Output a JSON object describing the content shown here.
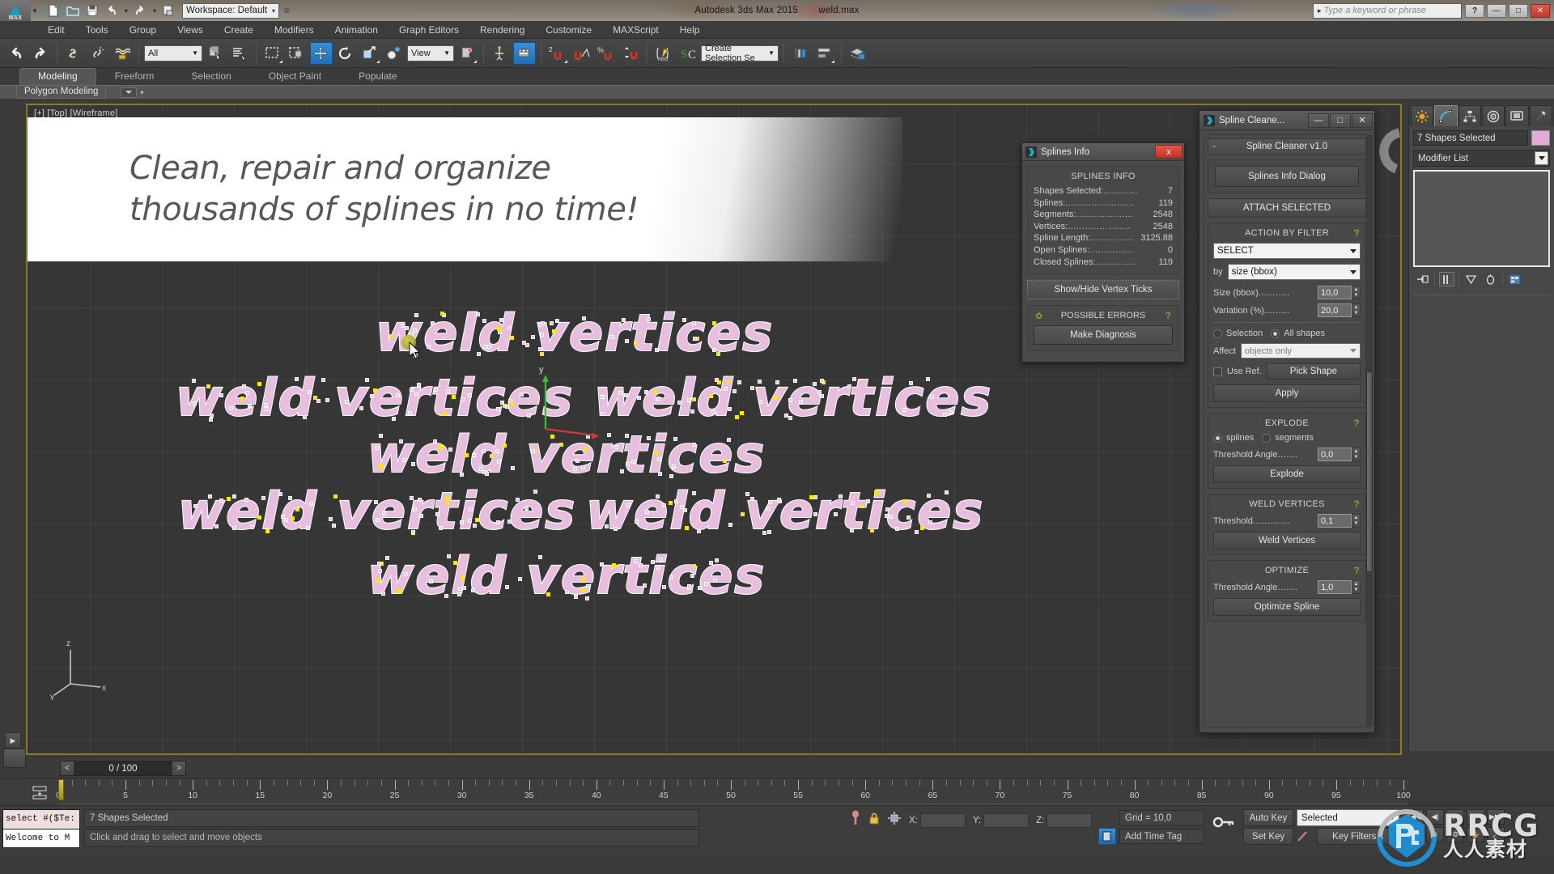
{
  "titlebar": {
    "app_title": "Autodesk 3ds Max  2015",
    "file_name": "weld.max",
    "workspace": "Workspace: Default",
    "search_placeholder": "Type a keyword or phrase",
    "logo_label": "MAX",
    "minimize": "—",
    "maximize": "□",
    "close": "✕",
    "help": "?"
  },
  "menu": {
    "items": [
      "Edit",
      "Tools",
      "Group",
      "Views",
      "Create",
      "Modifiers",
      "Animation",
      "Graph Editors",
      "Rendering",
      "Customize",
      "MAXScript",
      "Help"
    ]
  },
  "toolbar": {
    "selection_filter": "All",
    "reference_coord": "View",
    "named_selection_set": "Create Selection Se",
    "snap_label_2": "2",
    "snap_label_angle": "%"
  },
  "ribbon": {
    "tabs": [
      "Modeling",
      "Freeform",
      "Selection",
      "Object Paint",
      "Populate"
    ],
    "selected_tab": "Modeling",
    "panel_label": "Polygon Modeling"
  },
  "viewport": {
    "label": "[+] [Top] [Wireframe]",
    "banner_line1": "Clean, repair and organize",
    "banner_line2": "thousands of splines in no time!",
    "spline_text": "weld vertices",
    "axis_x": "x",
    "axis_y": "y",
    "axis_z": "z",
    "spline_color": "#e7bede",
    "selected_vertex_color": "#ffe800",
    "viewport_border_color": "#8a7a28"
  },
  "splines_info_dialog": {
    "title": "Splines Info",
    "close": "x",
    "group_title": "SPLINES INFO",
    "rows": [
      {
        "label": "Shapes Selected:",
        "dots": "............",
        "value": "7"
      },
      {
        "label": "Splines:",
        "dots": "........................",
        "value": "119"
      },
      {
        "label": "Segments:",
        "dots": "....................",
        "value": "2548"
      },
      {
        "label": "Vertices:",
        "dots": "......................",
        "value": "2548"
      },
      {
        "label": "Spline Length:",
        "dots": "...............",
        "value": "3125.88"
      },
      {
        "label": "Open Splines:",
        "dots": "...............",
        "value": "0"
      },
      {
        "label": "Closed Splines:",
        "dots": "..............",
        "value": "119"
      }
    ],
    "show_hide_button": "Show/Hide Vertex Ticks",
    "errors_title": "POSSIBLE ERRORS",
    "errors_help": "?",
    "make_diagnosis_button": "Make Diagnosis"
  },
  "spline_cleaner": {
    "window_title": "Spline Cleane...",
    "minimize": "—",
    "maximize": "□",
    "close": "✕",
    "rollout_title": "Spline Cleaner v1.0",
    "rollout_collapse": "-",
    "splines_info_dialog_button": "Splines Info Dialog",
    "attach_selected_button": "ATTACH SELECTED",
    "action_by_filter": {
      "title": "ACTION BY FILTER",
      "help": "?",
      "action": "SELECT",
      "by_label": "by",
      "by_value": "size (bbox)",
      "size_label": "Size (bbox)",
      "size_dots": "...........",
      "size_value": "10,0",
      "variation_label": "Variation (%)",
      "variation_dots": ".........",
      "variation_value": "20,0",
      "radio_selection": "Selection",
      "radio_all_shapes": "All shapes",
      "radio_selected": "All shapes",
      "affect_label": "Affect",
      "affect_value": "objects only",
      "use_ref_label": "Use Ref.",
      "pick_shape_button": "Pick Shape",
      "apply_button": "Apply"
    },
    "explode": {
      "title": "EXPLODE",
      "help": "?",
      "radio_splines": "splines",
      "radio_segments": "segments",
      "radio_selected": "splines",
      "threshold_label": "Threshold Angle",
      "threshold_dots": ".......",
      "threshold_value": "0,0",
      "button": "Explode"
    },
    "weld_vertices": {
      "title": "WELD VERTICES",
      "help": "?",
      "threshold_label": "Threshold",
      "threshold_dots": ".............",
      "threshold_value": "0,1",
      "button": "Weld Vertices"
    },
    "optimize": {
      "title": "OPTIMIZE",
      "help": "?",
      "threshold_label": "Threshold Angle",
      "threshold_dots": ".......",
      "threshold_value": "1,0",
      "button": "Optimize Spline"
    }
  },
  "command_panel": {
    "tabs": [
      "create-tab",
      "modify-tab",
      "hierarchy-tab",
      "motion-tab",
      "display-tab",
      "utilities-tab"
    ],
    "selected_tab_index": 1,
    "object_name": "7 Shapes Selected",
    "object_color": "#e3abd5",
    "modifier_list": "Modifier List"
  },
  "timeline": {
    "frame_display": "0 / 100",
    "prev_arrow": "<",
    "next_arrow": ">",
    "tick_labels": [
      0,
      5,
      10,
      15,
      20,
      25,
      30,
      35,
      40,
      45,
      50,
      55,
      60,
      65,
      70,
      75,
      80,
      85,
      90,
      95,
      100
    ],
    "range_start": 0,
    "range_end": 100,
    "current_frame": 0
  },
  "statusbar": {
    "maxscript_line1": "select #($Te:",
    "maxscript_line2": "Welcome to M",
    "selection_status": "7 Shapes Selected",
    "prompt": "Click and drag to select and move objects",
    "x_label": "X:",
    "y_label": "Y:",
    "z_label": "Z:",
    "x_value": "",
    "y_value": "",
    "z_value": "",
    "grid": "Grid = 10,0",
    "add_time_tag": "Add Time Tag",
    "auto_key": "Auto Key",
    "set_key": "Set Key",
    "key_mode": "Selected",
    "key_filters": "Key Filters..."
  },
  "watermark": {
    "brand": "RRCG",
    "subtitle": "人人素材"
  }
}
